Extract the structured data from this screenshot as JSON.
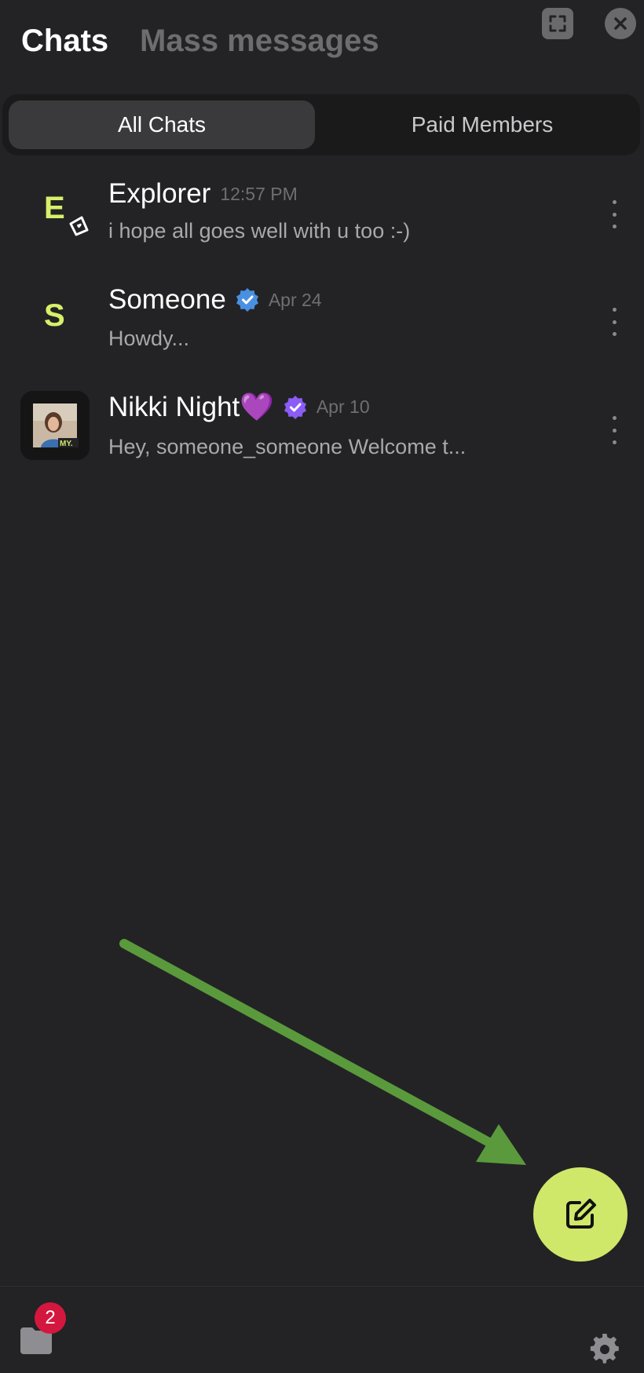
{
  "header": {
    "title": "Chats",
    "secondary_title": "Mass messages"
  },
  "tabs": [
    {
      "label": "All Chats",
      "active": true
    },
    {
      "label": "Paid Members",
      "active": false
    }
  ],
  "chats": [
    {
      "avatar_letter": "E",
      "name": "Explorer",
      "time": "12:57 PM",
      "preview": "i hope all goes well with u too :-)",
      "verified": false
    },
    {
      "avatar_letter": "S",
      "name": "Someone",
      "time": "Apr 24",
      "preview": "Howdy...",
      "verified": true,
      "verified_color": "#4a90e2"
    },
    {
      "avatar_letter": "",
      "name": "Nikki Night💜",
      "time": "Apr 10",
      "preview": "Hey, someone_someone Welcome t...",
      "verified": true,
      "verified_color": "#8b5cf6"
    }
  ],
  "bottom": {
    "badge_count": "2"
  },
  "colors": {
    "background": "#232325",
    "accent": "#cfe86a",
    "badge": "#d4173f",
    "annotation_arrow": "#5a9a3c"
  },
  "icons": {
    "expand": "expand-icon",
    "close": "close-icon",
    "compose": "compose-icon",
    "folder": "folder-icon",
    "settings": "gear-icon"
  }
}
